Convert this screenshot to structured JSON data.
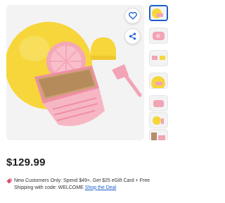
{
  "product": {
    "price": "$129.99"
  },
  "promo": {
    "text": "New Customers Only: Spend $49+, Get $25 eGift Card + Free Shipping with code: WELCOME",
    "link_label": "Shop the Deal"
  },
  "actions": {
    "favorite_icon": "heart-icon",
    "share_icon": "share-icon"
  },
  "gallery": {
    "selected_index": 0,
    "thumbnail_count": 7
  },
  "colors": {
    "accent": "#1c5fcf",
    "product_yellow": "#f6d63a",
    "product_pink": "#f2a4b6",
    "promo_tag": "#d64a68"
  }
}
